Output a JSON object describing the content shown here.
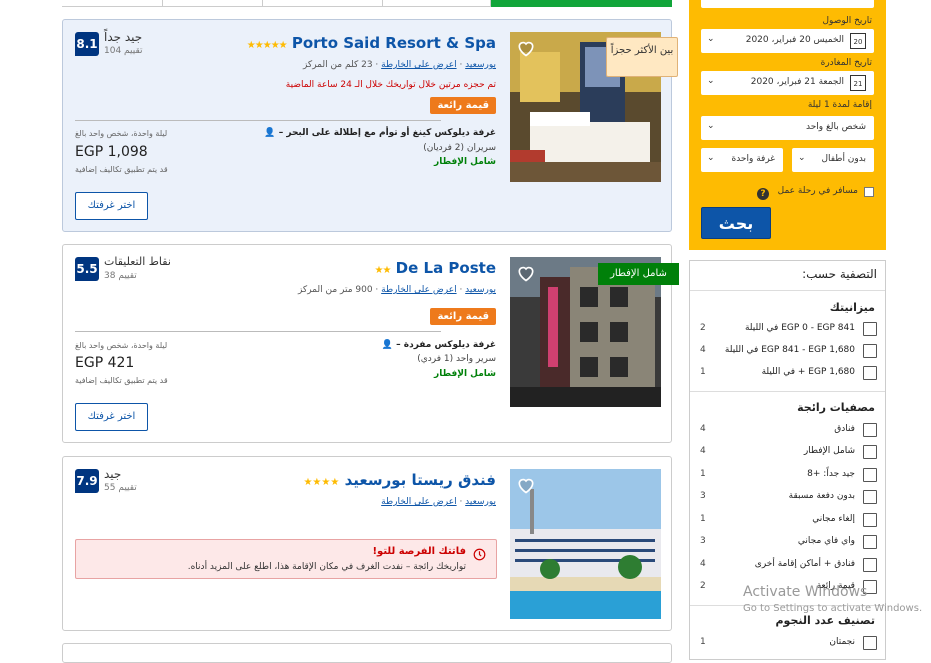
{
  "sidebar_search": {
    "checkin_label": "تاريخ الوصول",
    "checkin_value": "الخميس 20 فبراير، 2020",
    "checkin_day": "20",
    "checkout_label": "تاريخ المغادرة",
    "checkout_value": "الجمعة 21 فبراير، 2020",
    "checkout_day": "21",
    "stay_label": "إقامة لمدة 1 ليلة",
    "adults": "شخص بالغ واحد",
    "children": "بدون أطفال",
    "rooms": "غرفة واحدة",
    "work_trip": "مسافر في رحلة عمل",
    "search_button": "بحث"
  },
  "filters": {
    "title": "التصفية حسب:",
    "budget_title": "ميزانيتك",
    "budget": [
      {
        "label": "EGP 0 - EGP 841 في الليلة",
        "count": "2"
      },
      {
        "label": "EGP 841 - EGP 1,680 في الليلة",
        "count": "4"
      },
      {
        "label": "EGP 1,680 + في الليلة",
        "count": "1"
      }
    ],
    "popular_title": "مصفيات رائجة",
    "popular": [
      {
        "label": "فنادق",
        "count": "4"
      },
      {
        "label": "شامل الإفطار",
        "count": "4"
      },
      {
        "label": "جيد جداً: +8",
        "count": "1"
      },
      {
        "label": "بدون دفعة مسبقة",
        "count": "3"
      },
      {
        "label": "إلغاء مجاني",
        "count": "1"
      },
      {
        "label": "واي فاي مجاني",
        "count": "3"
      },
      {
        "label": "فنادق + أماكن إقامة أخرى",
        "count": "4"
      },
      {
        "label": "قيمة رائعة",
        "count": "2"
      }
    ],
    "stars_title": "تصنيف عدد النجوم",
    "stars": [
      {
        "label": "نجمتان",
        "count": "1"
      }
    ]
  },
  "hotels": [
    {
      "name": "Porto Said Resort & Spa",
      "stars": "★★★★★",
      "score": "8.1",
      "score_label": "جيد جداً",
      "reviews": "104 تقييم",
      "city": "بورسعيد",
      "map": "اعرض على الخارطة",
      "distance": "23 كلم من المركز",
      "booked_note": "تم حجزه مرتين خلال تواريخك خلال الـ 24 ساعة الماضية",
      "value_badge": "قيمة رائعة",
      "ribbon": "بين الأكثر حجزاً",
      "room": "غرفة ديلوكس كينغ أو توأم مع إطلالة على البحر",
      "bed": "سريران (2 فرديان)",
      "breakfast": "شامل الإفطار",
      "price_note": "ليلة واحدة، شخص واحد بالغ",
      "price": "EGP 1,098",
      "extra": "قد يتم تطبيق تكاليف إضافية",
      "choose": "اختر غرفتك"
    },
    {
      "name": "De La Poste",
      "stars": "★★",
      "score": "5.5",
      "score_label": "نقاط التعليقات",
      "reviews": "38 تقييم",
      "city": "بورسعيد",
      "map": "اعرض على الخارطة",
      "distance": "900 متر من المركز",
      "value_badge": "قيمة رائعة",
      "ribbon": "شامل الإفطار",
      "room": "غرفة ديلوكس مفردة",
      "bed": "سرير واحد (1 فردي)",
      "breakfast": "شامل الإفطار",
      "price_note": "ليلة واحدة، شخص واحد بالغ",
      "price": "EGP 421",
      "extra": "قد يتم تطبيق تكاليف إضافية",
      "choose": "اختر غرفتك"
    },
    {
      "name": "فندق ريستا بورسعيد",
      "stars": "★★★★",
      "score": "7.9",
      "score_label": "جيد",
      "reviews": "55 تقييم",
      "city": "بورسعيد",
      "map": "اعرض على الخارطة",
      "alert_title": "فاتتك الفرصة للتو!",
      "alert_text": "تواريخك رائجة – نفدت الغرف في مكان الإقامة هذا، اطلع على المزيد أدناه."
    }
  ],
  "watermark": {
    "title": "Activate Windows",
    "sub": "Go to Settings to activate Windows."
  }
}
